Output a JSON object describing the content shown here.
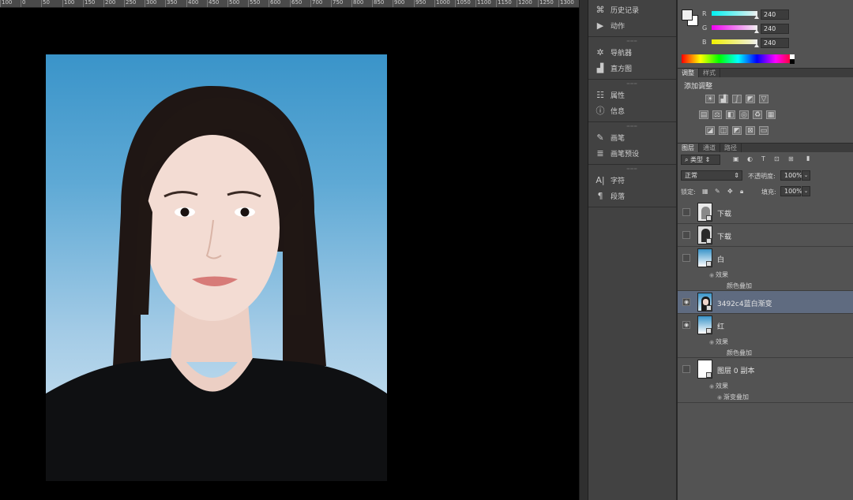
{
  "ruler": {
    "ticks": [
      "100",
      "0",
      "50",
      "100",
      "150",
      "200",
      "250",
      "300",
      "350",
      "400",
      "450",
      "500",
      "550",
      "600",
      "650",
      "700",
      "750",
      "800",
      "850",
      "900",
      "950",
      "1000",
      "1050",
      "1100",
      "1150",
      "1200",
      "1250",
      "1300"
    ]
  },
  "panels": {
    "group1": [
      {
        "icon": "history-icon",
        "label": "历史记录"
      },
      {
        "icon": "play-icon",
        "label": "动作"
      }
    ],
    "group2": [
      {
        "icon": "navigator-icon",
        "label": "导航器"
      },
      {
        "icon": "histogram-icon",
        "label": "直方图"
      }
    ],
    "group3": [
      {
        "icon": "properties-icon",
        "label": "属性"
      },
      {
        "icon": "info-icon",
        "label": "信息"
      }
    ],
    "group4": [
      {
        "icon": "brush-icon",
        "label": "画笔"
      },
      {
        "icon": "brush-presets-icon",
        "label": "画笔预设"
      }
    ],
    "group5": [
      {
        "icon": "character-icon",
        "label": "字符"
      },
      {
        "icon": "paragraph-icon",
        "label": "段落"
      }
    ]
  },
  "color_panel": {
    "r_label": "R",
    "g_label": "G",
    "b_label": "B",
    "r": "240",
    "g": "240",
    "b": "240",
    "foreground": "#f0f0f0",
    "background": "#ffffff"
  },
  "adjustments": {
    "tabs": [
      "调整",
      "样式"
    ],
    "title": "添加调整"
  },
  "layers_panel": {
    "tabs": [
      "图层",
      "通道",
      "路径"
    ],
    "filter": "类型",
    "blend_mode": "正常",
    "opacity_label": "不透明度:",
    "opacity": "100%",
    "lock_label": "锁定:",
    "fill_label": "填充:",
    "fill": "100%",
    "layers": [
      {
        "name": "下载",
        "visible": false,
        "effects": null
      },
      {
        "name": "下载",
        "visible": false,
        "effects": null
      },
      {
        "name": "白",
        "visible": false,
        "effects_label": "效果",
        "effect": "颜色叠加"
      },
      {
        "name": "3492c4蓝白渐变",
        "visible": true,
        "selected": true
      },
      {
        "name": "红",
        "visible": true,
        "effects_label": "效果",
        "effect": "颜色叠加"
      },
      {
        "name": "图层 0 副本",
        "visible": false,
        "effects_label": "效果",
        "effect": "渐变叠加"
      }
    ]
  }
}
